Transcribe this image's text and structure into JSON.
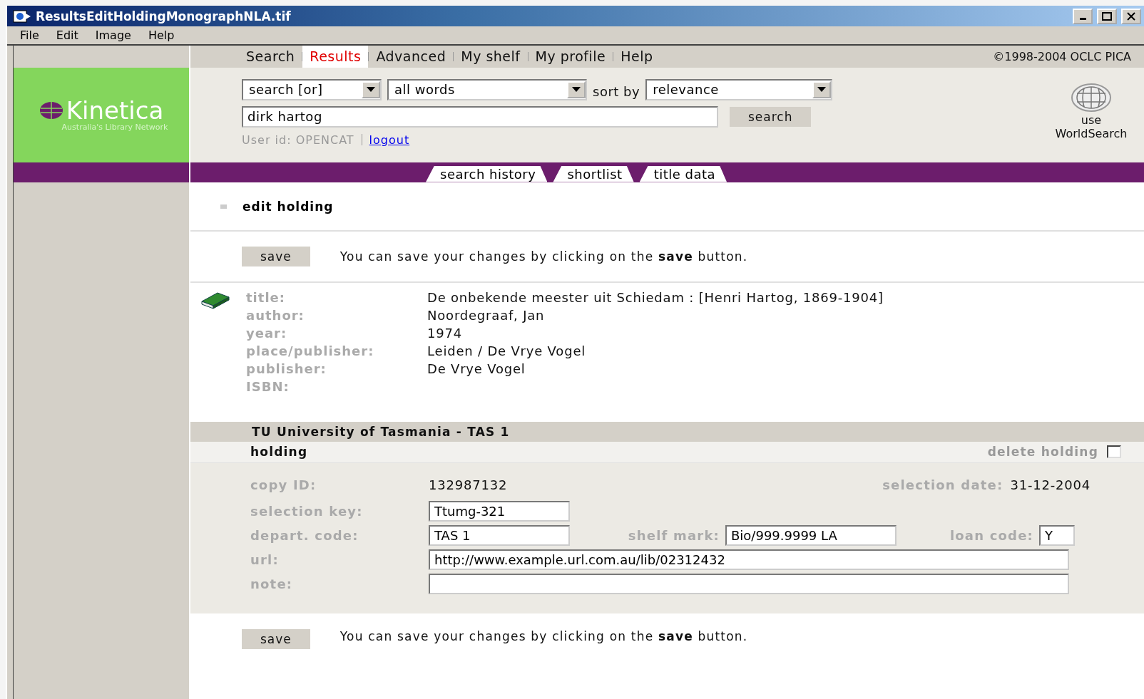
{
  "window": {
    "title": "ResultsEditHoldingMonographNLA.tif"
  },
  "menu": [
    "File",
    "Edit",
    "Image",
    "Help"
  ],
  "nav": {
    "tabs": [
      {
        "label": "Search",
        "selected": false
      },
      {
        "label": "Results",
        "selected": true
      },
      {
        "label": "Advanced",
        "selected": false
      },
      {
        "label": "My shelf",
        "selected": false
      },
      {
        "label": "My profile",
        "selected": false
      },
      {
        "label": "Help",
        "selected": false
      }
    ],
    "copyright": "©1998-2004 OCLC PICA"
  },
  "logo": {
    "name": "Kinetica",
    "tagline": "Australia's Library Network"
  },
  "search": {
    "scope": "search [or]",
    "match": "all words",
    "sort_label": "sort by",
    "sort": "relevance",
    "query": "dirk hartog",
    "button": "search",
    "user": "User id: OPENCAT",
    "logout": "logout",
    "worldsearch": "use WorldSearch"
  },
  "subtabs": [
    "search history",
    "shortlist",
    "title data"
  ],
  "heading": "edit holding",
  "save_bars": [
    {
      "button": "save",
      "hint": "You can save your changes by clicking on the **save** button."
    },
    {
      "button": "save",
      "hint": "You can save your changes by clicking on the **save** button."
    }
  ],
  "record": [
    {
      "label": "title:",
      "value": "De onbekende meester uit Schiedam : [Henri Hartog, 1869-1904]"
    },
    {
      "label": "author:",
      "value": "Noordegraaf, Jan"
    },
    {
      "label": "year:",
      "value": "1974"
    },
    {
      "label": "place/publisher:",
      "value": "Leiden / De Vrye Vogel"
    },
    {
      "label": "publisher:",
      "value": "De Vrye Vogel"
    },
    {
      "label": "ISBN:"
    }
  ],
  "holding": {
    "institution": "TU University of Tasmania - TAS 1",
    "heading": "holding",
    "delete_label": "delete holding",
    "delete_checked": false,
    "copy_id_label": "copy ID:",
    "copy_id": "132987132",
    "selection_date_label": "selection date:",
    "selection_date": "31-12-2004",
    "selection_key_label": "selection key:",
    "selection_key": "Ttumg-321",
    "depart_code_label": "depart. code:",
    "depart_code": "TAS 1",
    "shelf_mark_label": "shelf mark:",
    "shelf_mark": "Bio/999.9999 LA",
    "loan_code_label": "loan code:",
    "loan_code": "Y",
    "url_label": "url:",
    "url": "http://www.example.url.com.au/lib/02312432",
    "note_label": "note:"
  }
}
